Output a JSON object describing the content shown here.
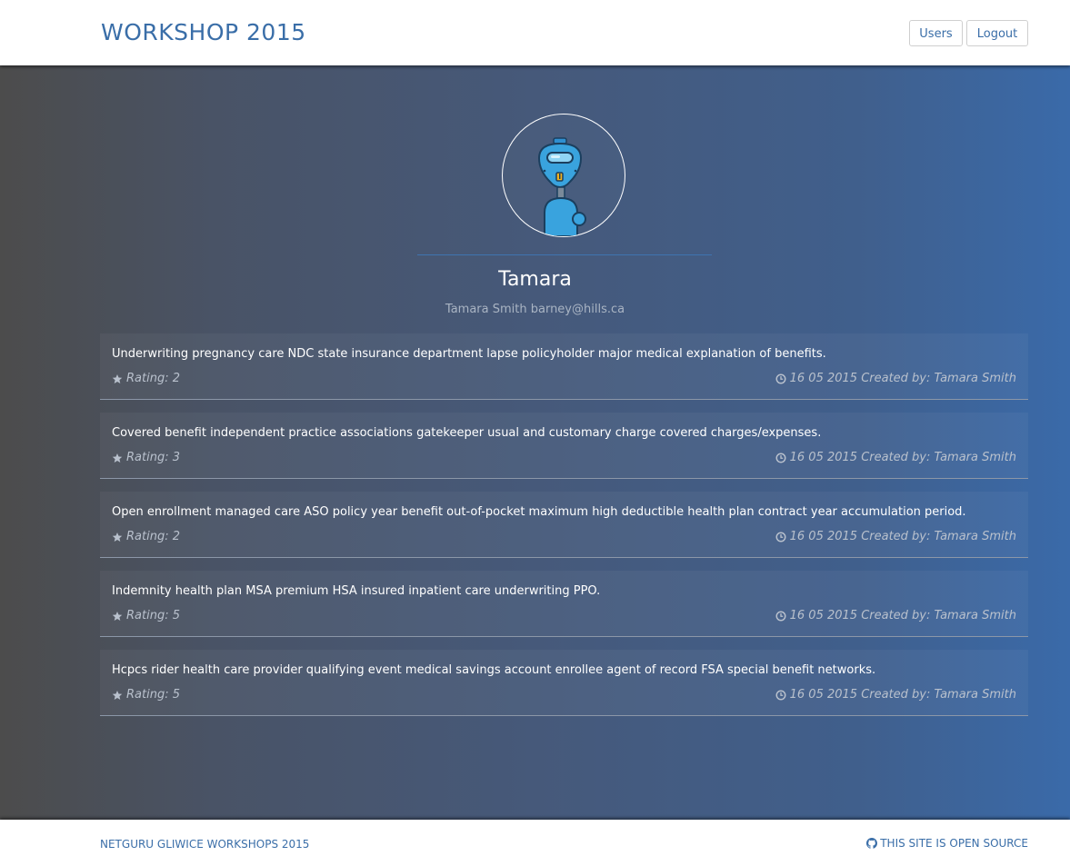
{
  "header": {
    "brand": "WORKSHOP 2015",
    "users_label": "Users",
    "logout_label": "Logout"
  },
  "profile": {
    "name": "Tamara",
    "subtitle": "Tamara Smith barney@hills.ca",
    "avatar_icon": "robot-avatar-icon"
  },
  "posts": [
    {
      "text": "Underwriting pregnancy care NDC state insurance department lapse policyholder major medical explanation of benefits.",
      "rating": "Rating: 2",
      "meta": "16 05 2015 Created by: Tamara Smith"
    },
    {
      "text": "Covered benefit independent practice associations gatekeeper usual and customary charge covered charges/expenses.",
      "rating": "Rating: 3",
      "meta": "16 05 2015 Created by: Tamara Smith"
    },
    {
      "text": "Open enrollment managed care ASO policy year benefit out-of-pocket maximum high deductible health plan contract year accumulation period.",
      "rating": "Rating: 2",
      "meta": "16 05 2015 Created by: Tamara Smith"
    },
    {
      "text": "Indemnity health plan MSA premium HSA insured inpatient care underwriting PPO.",
      "rating": "Rating: 5",
      "meta": "16 05 2015 Created by: Tamara Smith"
    },
    {
      "text": "Hcpcs rider health care provider qualifying event medical savings account enrollee agent of record FSA special benefit networks.",
      "rating": "Rating: 5",
      "meta": "16 05 2015 Created by: Tamara Smith"
    }
  ],
  "footer": {
    "left": "NETGURU GLIWICE WORKSHOPS 2015",
    "right": "THIS SITE IS OPEN SOURCE",
    "right_icon": "github-icon"
  },
  "colors": {
    "accent": "#3a6ea8",
    "gradient_left": "#4c4c4c",
    "gradient_right": "#3a6aa9"
  }
}
